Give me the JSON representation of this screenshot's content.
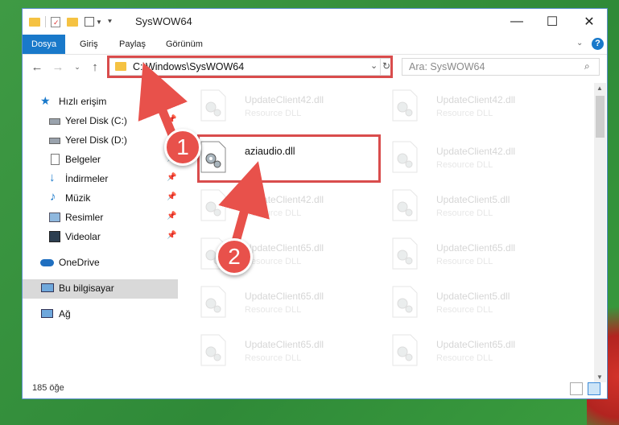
{
  "window": {
    "title": "SysWOW64",
    "controls": {
      "minimize": "—",
      "maximize": "☐",
      "close": "✕"
    }
  },
  "ribbon": {
    "tabs": [
      "Dosya",
      "Giriş",
      "Paylaş",
      "Görünüm"
    ],
    "active_tab": "Dosya",
    "help": "?"
  },
  "nav": {
    "address": "C:\\Windows\\SysWOW64",
    "search_placeholder": "Ara: SysWOW64"
  },
  "sidebar": {
    "items": [
      {
        "label": "Hızlı erişim",
        "icon": "star-icon"
      },
      {
        "label": "Yerel Disk (C:)",
        "icon": "drive-icon"
      },
      {
        "label": "Yerel Disk (D:)",
        "icon": "drive-icon"
      },
      {
        "label": "Belgeler",
        "icon": "document-icon"
      },
      {
        "label": "İndirmeler",
        "icon": "download-icon"
      },
      {
        "label": "Müzik",
        "icon": "music-icon"
      },
      {
        "label": "Resimler",
        "icon": "pictures-icon"
      },
      {
        "label": "Videolar",
        "icon": "video-icon"
      },
      {
        "label": "OneDrive",
        "icon": "cloud-icon"
      },
      {
        "label": "Bu bilgisayar",
        "icon": "computer-icon"
      },
      {
        "label": "Ağ",
        "icon": "network-icon"
      }
    ],
    "selected": "Bu bilgisayar"
  },
  "files": [
    {
      "name": "UpdateClient42.dll",
      "desc": "Resource DLL"
    },
    {
      "name": "UpdateClient42.dll",
      "desc": "Resource DLL"
    },
    {
      "name": "aziaudio.dll",
      "desc": ""
    },
    {
      "name": "UpdateClient42.dll",
      "desc": "Resource DLL"
    },
    {
      "name": "UpdateClient42.dll",
      "desc": "Resource DLL"
    },
    {
      "name": "UpdateClient5.dll",
      "desc": "Resource DLL"
    },
    {
      "name": "UpdateClient65.dll",
      "desc": "Resource DLL"
    },
    {
      "name": "UpdateClient65.dll",
      "desc": "Resource DLL"
    },
    {
      "name": "UpdateClient65.dll",
      "desc": "Resource DLL"
    },
    {
      "name": "UpdateClient5.dll",
      "desc": "Resource DLL"
    },
    {
      "name": "UpdateClient65.dll",
      "desc": "Resource DLL"
    },
    {
      "name": "UpdateClient65.dll",
      "desc": "Resource DLL"
    }
  ],
  "status": {
    "count": "185 öğe"
  },
  "callouts": [
    "1",
    "2"
  ],
  "colors": {
    "accent": "#1979ca",
    "highlight": "#d94c4c",
    "callout": "#e8514b"
  }
}
